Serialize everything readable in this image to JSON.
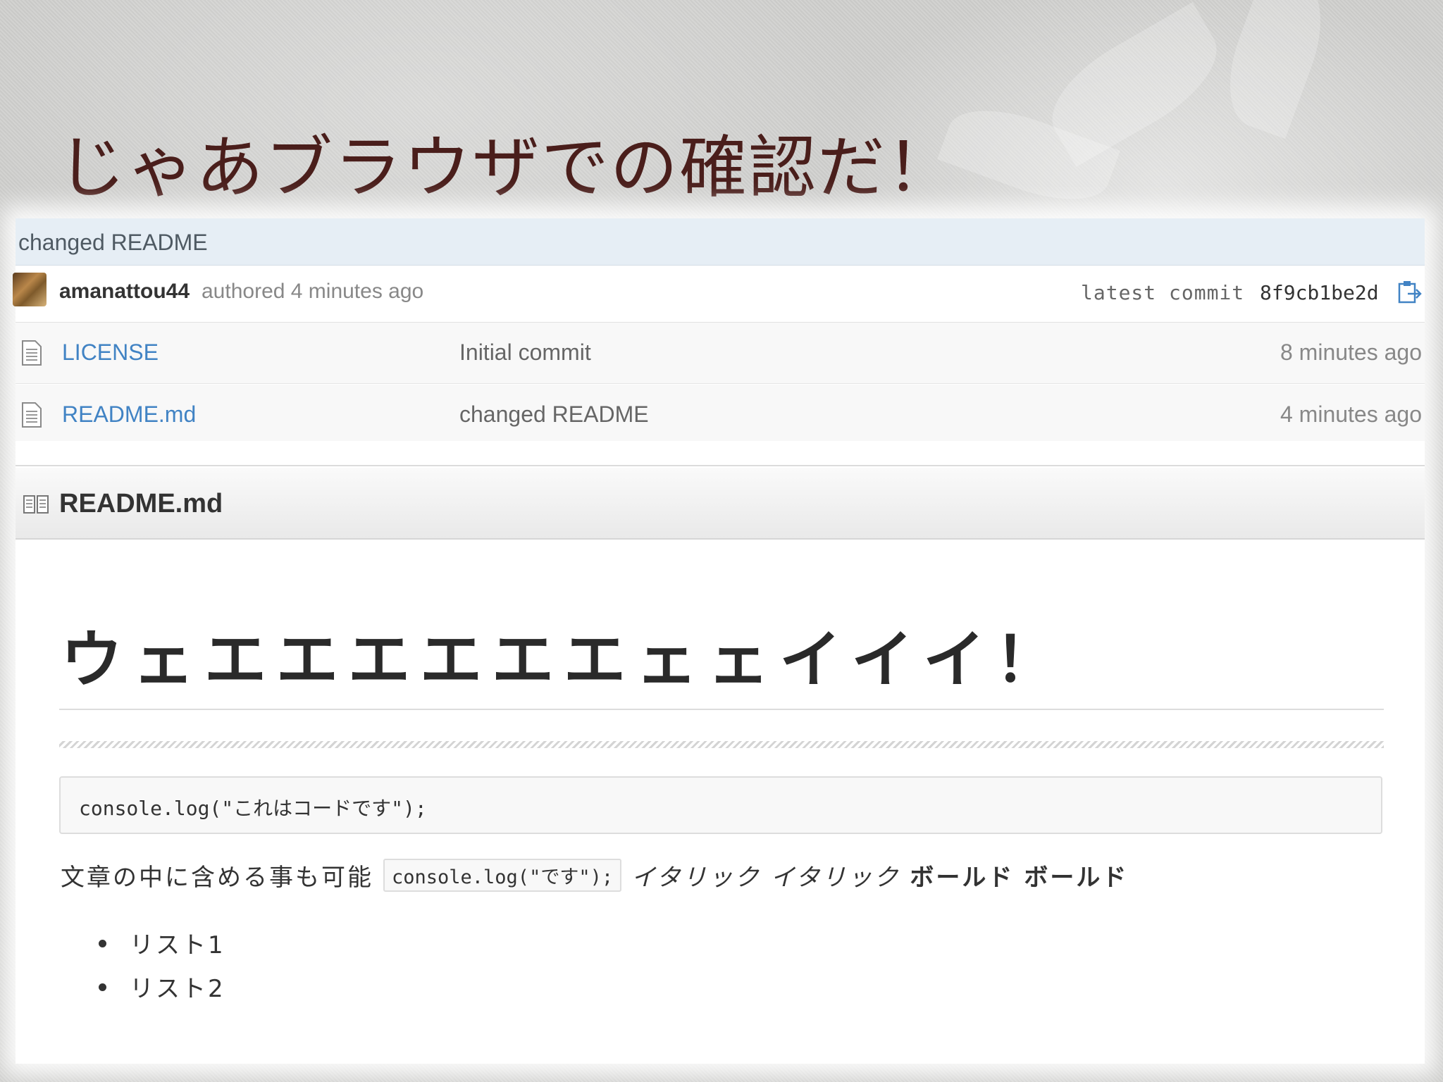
{
  "slide": {
    "title": "じゃあブラウザでの確認だ！"
  },
  "commit": {
    "message": "changed README",
    "author": "amanattou44",
    "authored_text": "authored 4 minutes ago",
    "latest_commit_label": "latest commit",
    "sha": "8f9cb1be2d"
  },
  "files": [
    {
      "name": "LICENSE",
      "message": "Initial commit",
      "age": "8 minutes ago"
    },
    {
      "name": "README.md",
      "message": "changed README",
      "age": "4 minutes ago"
    }
  ],
  "readme": {
    "filename": "README.md",
    "h1": "ウェエエエエエエェェイイイ！",
    "code_block": "console.log(\"これはコードです\");",
    "para_text": "文章の中に含める事も可能",
    "inline_code": "console.log(\"です\");",
    "italic_1": "イタリック",
    "italic_2": "イタリック",
    "bold_1": "ボールド",
    "bold_2": "ボールド",
    "list": [
      "リスト1",
      "リスト2"
    ]
  },
  "icons": {
    "clipboard": "clipboard-icon",
    "file": "file-text-icon",
    "book": "book-icon"
  },
  "colors": {
    "title": "#4a1e1b",
    "link": "#4183c4",
    "commit_bar": "#e6eef5"
  }
}
